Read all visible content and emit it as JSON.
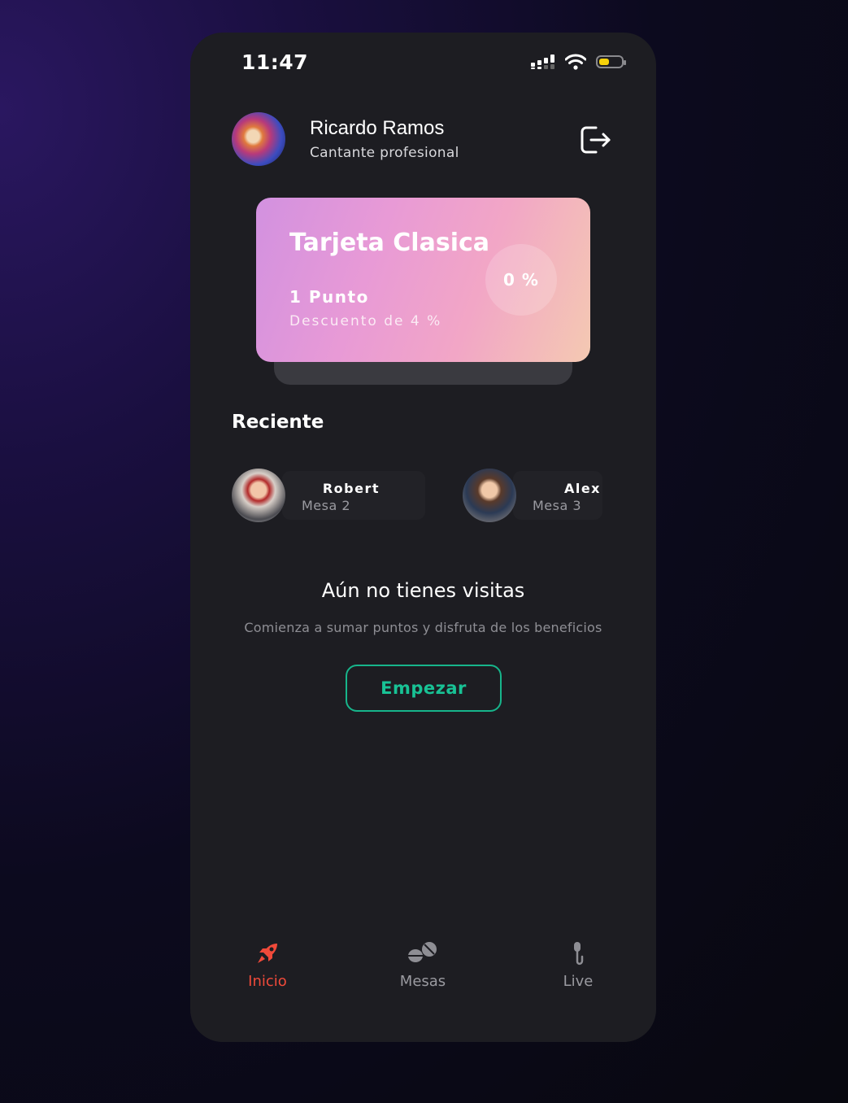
{
  "status_bar": {
    "time": "11:47"
  },
  "profile": {
    "name": "Ricardo Ramos",
    "role": "Cantante profesional"
  },
  "card": {
    "title": "Tarjeta Clasica",
    "points": "1 Punto",
    "discount": "Descuento de 4 %",
    "progress": "0 %"
  },
  "recent": {
    "title": "Reciente",
    "items": [
      {
        "name": "Robert",
        "table": "Mesa 2"
      },
      {
        "name": "Alex",
        "table": "Mesa 3"
      }
    ]
  },
  "empty_state": {
    "title": "Aún no tienes visitas",
    "subtitle": "Comienza a sumar puntos y disfruta de los beneficios",
    "button": "Empezar"
  },
  "tabs": [
    {
      "label": "Inicio",
      "icon": "rocket-icon",
      "active": true
    },
    {
      "label": "Mesas",
      "icon": "tables-icon",
      "active": false
    },
    {
      "label": "Live",
      "icon": "microphone-icon",
      "active": false
    }
  ],
  "colors": {
    "accent_green": "#18c295",
    "active_tab": "#f04a3a",
    "battery": "#f5d10a"
  }
}
